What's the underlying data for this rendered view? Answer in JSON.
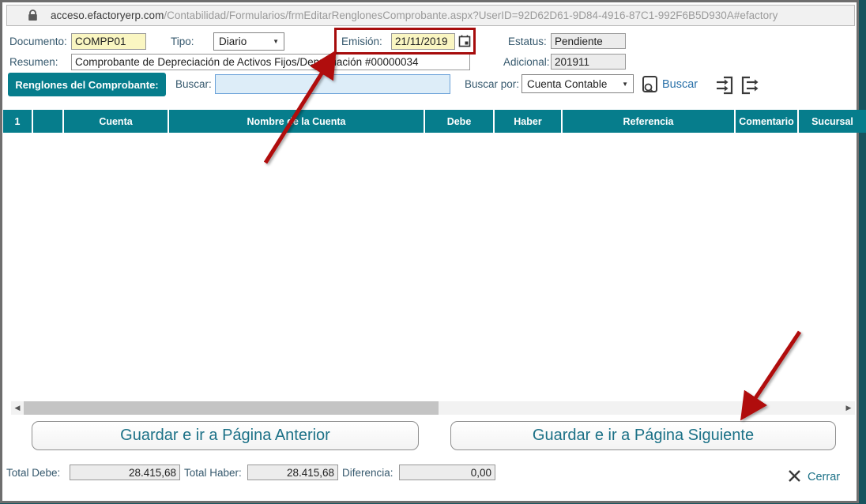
{
  "browser": {
    "url_host": "acceso.efactoryerp.com",
    "url_path": "/Contabilidad/Formularios/frmEditarRenglonesComprobante.aspx?UserID=92D62D61-9D84-4916-87C1-992F6B5D930A#efactory"
  },
  "form": {
    "documento": {
      "label": "Documento:",
      "value": "COMPP01"
    },
    "tipo": {
      "label": "Tipo:",
      "value": "Diario"
    },
    "emision": {
      "label": "Emisión:",
      "value": "21/11/2019"
    },
    "estatus": {
      "label": "Estatus:",
      "value": "Pendiente"
    },
    "resumen": {
      "label": "Resumen:",
      "value": "Comprobante de Depreciación de Activos Fijos/Depreciación #00000034"
    },
    "adicional": {
      "label": "Adicional:",
      "value": "201911"
    }
  },
  "toolbar": {
    "renglones_label": "Renglones del Comprobante:",
    "buscar_label": "Buscar:",
    "search_value": "",
    "buscar_por_label": "Buscar por:",
    "buscar_por_value": "Cuenta Contable",
    "buscar_button": "Buscar"
  },
  "table": {
    "headers": [
      "1",
      "",
      "Cuenta",
      "Nombre de la Cuenta",
      "Debe",
      "Haber",
      "Referencia",
      "Comentario",
      "Sucursal"
    ]
  },
  "buttons": {
    "prev": "Guardar e ir a Página Anterior",
    "next": "Guardar e ir a Página Siguiente"
  },
  "totals": {
    "total_debe_label": "Total Debe:",
    "total_debe": "28.415,68",
    "total_haber_label": "Total Haber:",
    "total_haber": "28.415,68",
    "diferencia_label": "Diferencia:",
    "diferencia": "0,00"
  },
  "footer": {
    "cerrar": "Cerrar"
  },
  "colors": {
    "teal": "#067d8c",
    "annotation_red": "#a60c0c",
    "highlight_yellow": "#faf6c2"
  }
}
